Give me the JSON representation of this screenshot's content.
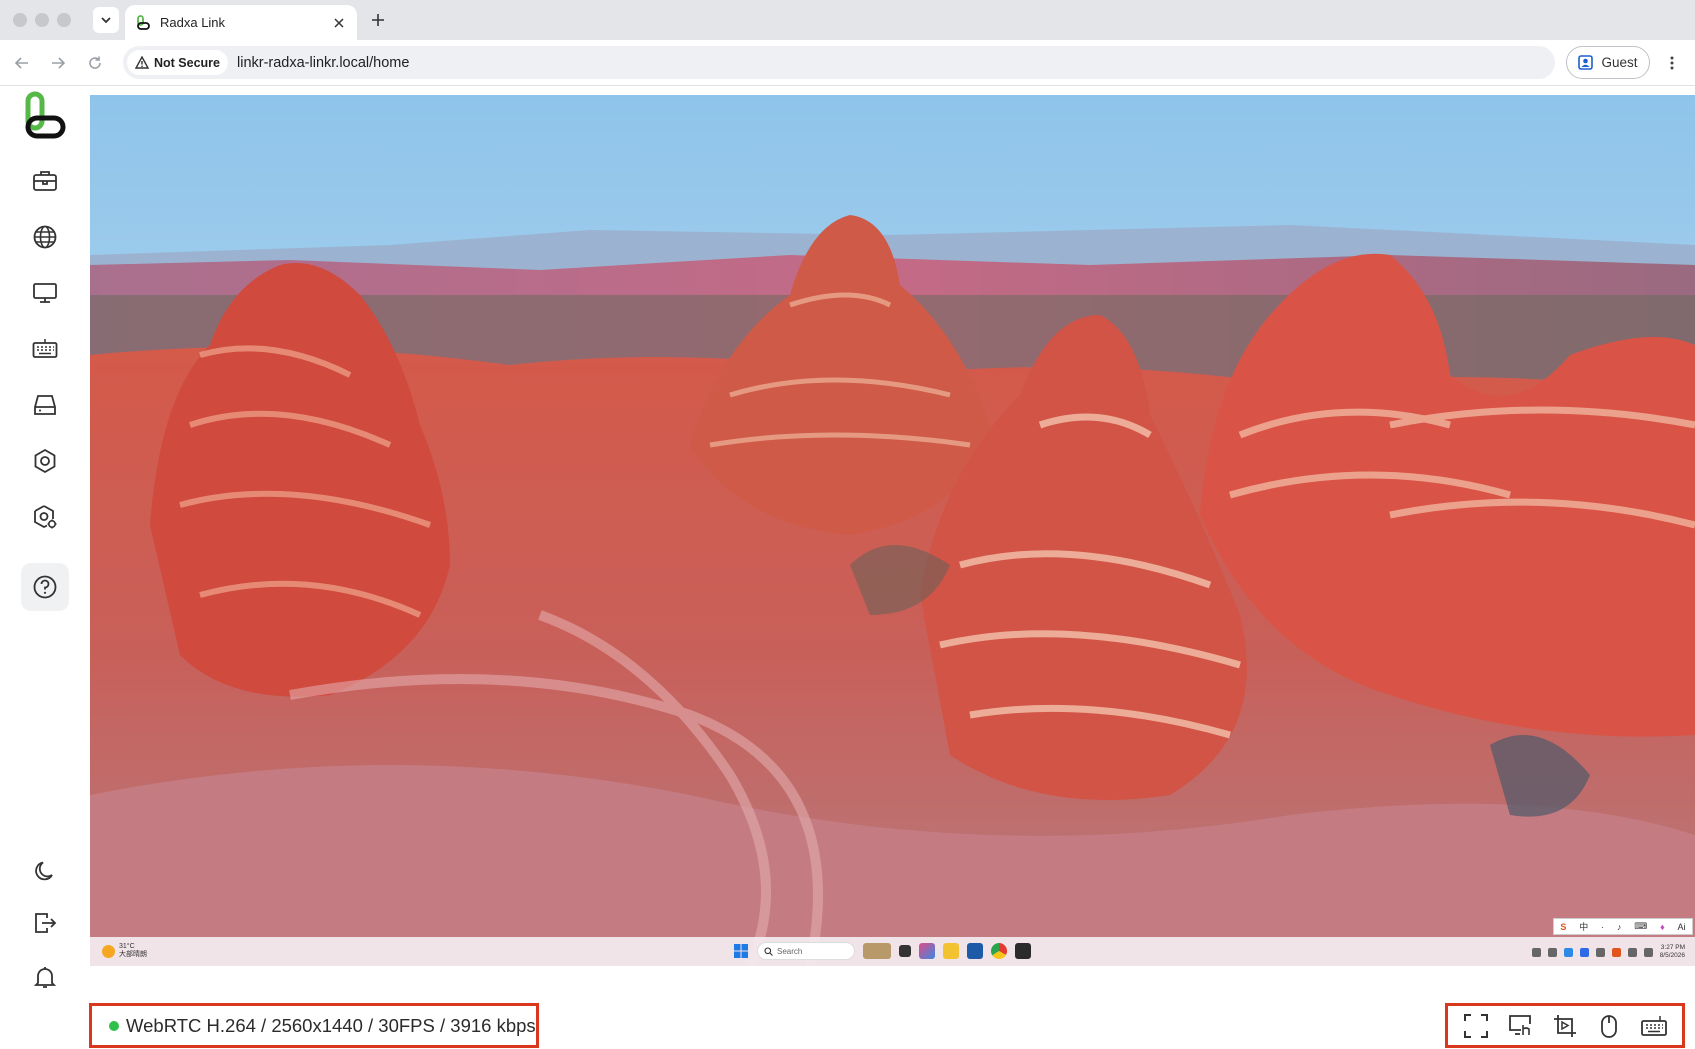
{
  "browser": {
    "tab_title": "Radxa Link",
    "security_label": "Not Secure",
    "url": "linkr-radxa-linkr.local/home",
    "profile_label": "Guest"
  },
  "sidebar": {
    "items": [
      {
        "icon": "toolbox-icon"
      },
      {
        "icon": "globe-icon"
      },
      {
        "icon": "monitor-icon"
      },
      {
        "icon": "keyboard-icon"
      },
      {
        "icon": "storage-drive-icon"
      },
      {
        "icon": "hexagon-settings-icon"
      },
      {
        "icon": "device-settings-icon"
      },
      {
        "icon": "help-icon",
        "active": true
      }
    ],
    "bottom_items": [
      {
        "icon": "moon-icon"
      },
      {
        "icon": "logout-icon"
      },
      {
        "icon": "bell-icon"
      }
    ]
  },
  "remote_screen": {
    "taskbar": {
      "temperature": "31°C",
      "weather_text": "大部晴朗",
      "search_placeholder": "Search",
      "time": "3:27 PM",
      "date": "8/5/2026"
    },
    "ime_bar": [
      "S",
      "中",
      "·",
      "♪",
      "⌨",
      "♦",
      "Ai"
    ]
  },
  "status": {
    "stream_info": "WebRTC H.264 / 2560x1440 / 30FPS / 3916 kbps",
    "live_color": "#2fbf4a",
    "highlight_color": "#d9381e"
  },
  "controls": [
    {
      "icon": "fullscreen-icon"
    },
    {
      "icon": "screen-touch-icon"
    },
    {
      "icon": "screen-capture-icon"
    },
    {
      "icon": "mouse-icon"
    },
    {
      "icon": "keyboard-icon"
    }
  ],
  "colors": {
    "brand_green": "#57b84a",
    "accent_red": "#d9381e"
  }
}
